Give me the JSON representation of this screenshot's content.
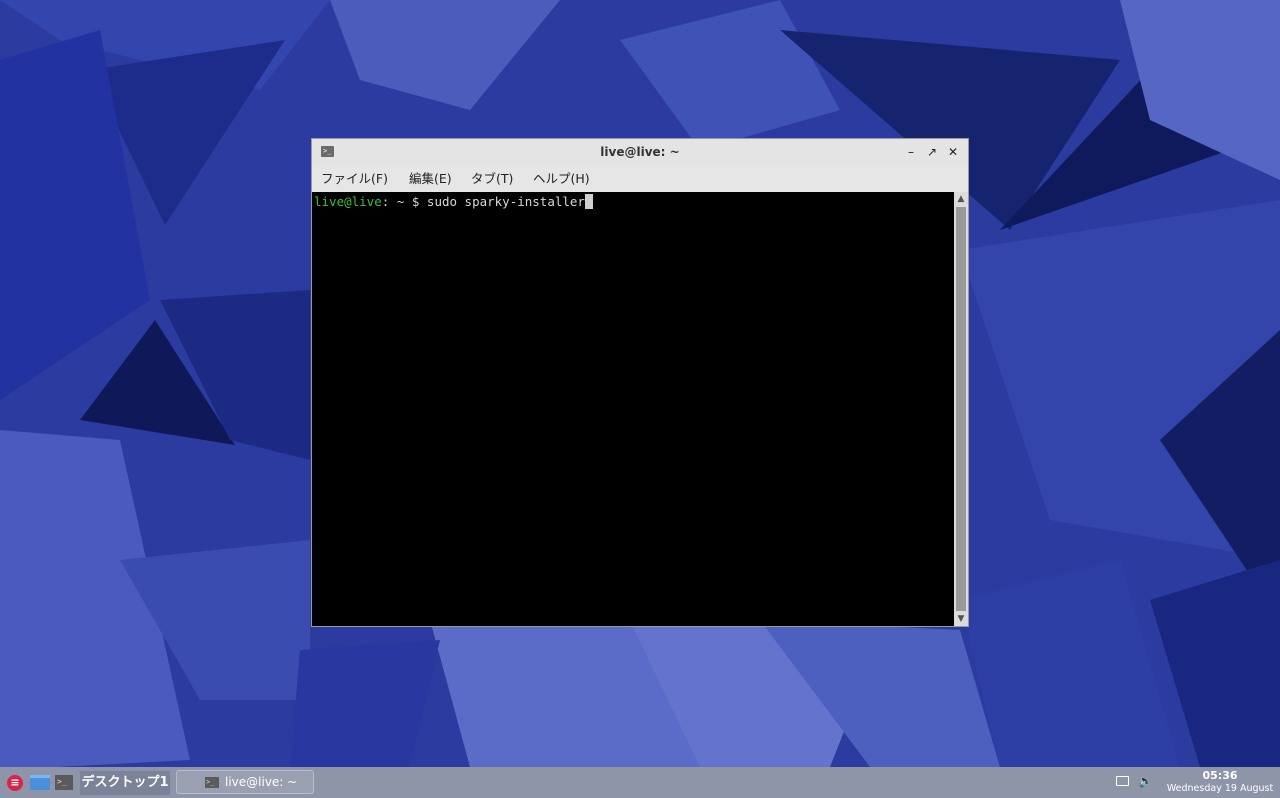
{
  "window": {
    "title": "live@live: ~",
    "buttons": {
      "minimize": "–",
      "maximize": "↗",
      "close": "✕"
    }
  },
  "menubar": {
    "items": [
      "ファイル(F)",
      "編集(E)",
      "タブ(T)",
      "ヘルプ(H)"
    ]
  },
  "terminal": {
    "prompt_user": "live@live",
    "prompt_sep": ": ",
    "prompt_dir": "~",
    "prompt_symbol": "$",
    "command": "sudo sparky-installer"
  },
  "taskbar": {
    "desktop_label": "デスクトップ1",
    "task_label": "live@live: ~",
    "clock_time": "05:36",
    "clock_date": "Wednesday 19 August"
  },
  "colors": {
    "wallpaper": "#2a3a9e",
    "prompt_user": "#3fbf3f",
    "taskbar": "#8e95a8"
  },
  "icons": {
    "app_menu": "app-menu-icon",
    "file_manager": "folder-icon",
    "terminal_launcher": "terminal-icon",
    "display": "display-icon",
    "volume": "volume-icon"
  }
}
